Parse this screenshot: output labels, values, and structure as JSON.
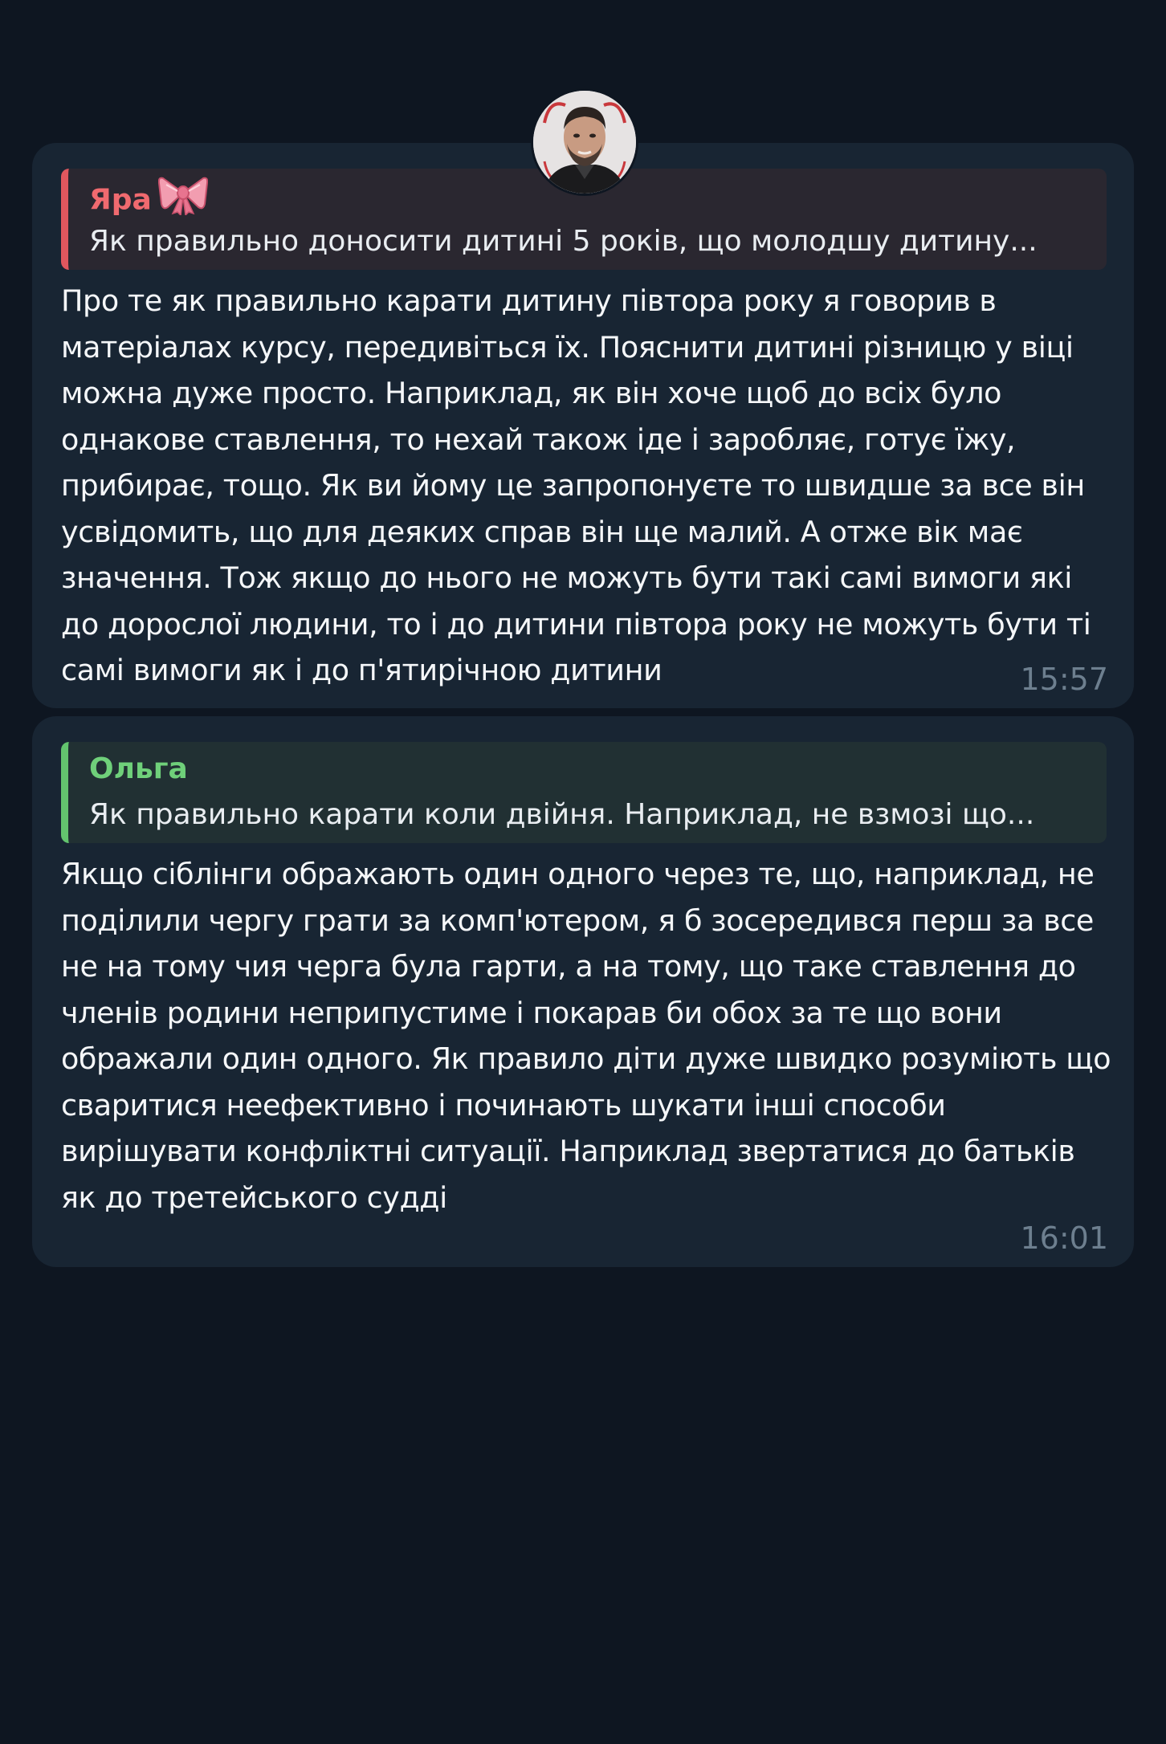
{
  "messages": [
    {
      "reply": {
        "author": "Яра",
        "author_icon": "bow-icon",
        "text": "Як правильно доносити дитині 5 років, що молодшу дитину...",
        "accent": "#e0575e"
      },
      "text": "Про те як правильно карати дитину півтора року я говорив в матеріалах курсу, передивіться їх. Пояснити дитині різницю у віці можна дуже просто. Наприклад, як він хоче щоб до всіх було однакове ставлення, то нехай також іде і заробляє, готує їжу, прибирає, тощо. Як ви йому це запропонуєте то швидше за все він усвідомить, що для деяких справ він ще малий. А отже вік має значення. Тож якщо до нього не можуть бути такі самі вимоги які до дорослої людини, то і до дитини півтора року не можуть бути ті самі вимоги як і до п'ятирічною дитини",
      "time": "15:57"
    },
    {
      "reply": {
        "author": "Ольга",
        "text": "Як правильно карати коли двійня. Наприклад, не взмозі що...",
        "accent": "#63c46e"
      },
      "text": "Якщо сіблінги ображають один одного через те, що, наприклад, не поділили чергу грати за комп'ютером, я б зосередився перш за все не на тому чия черга була гарти, а на тому, що таке ставлення до членів родини неприпустиме і покарав би обох за те що вони ображали один одного. Як правило діти дуже швидко розуміють що сваритися неефективно і починають шукати інші способи вирішувати конфліктні ситуації. Наприклад звертатися до батьків як до третейського судді",
      "time": "16:01"
    }
  ],
  "colors": {
    "background": "#0e1621",
    "bubble": "#182533",
    "time": "#6d7f8f"
  }
}
